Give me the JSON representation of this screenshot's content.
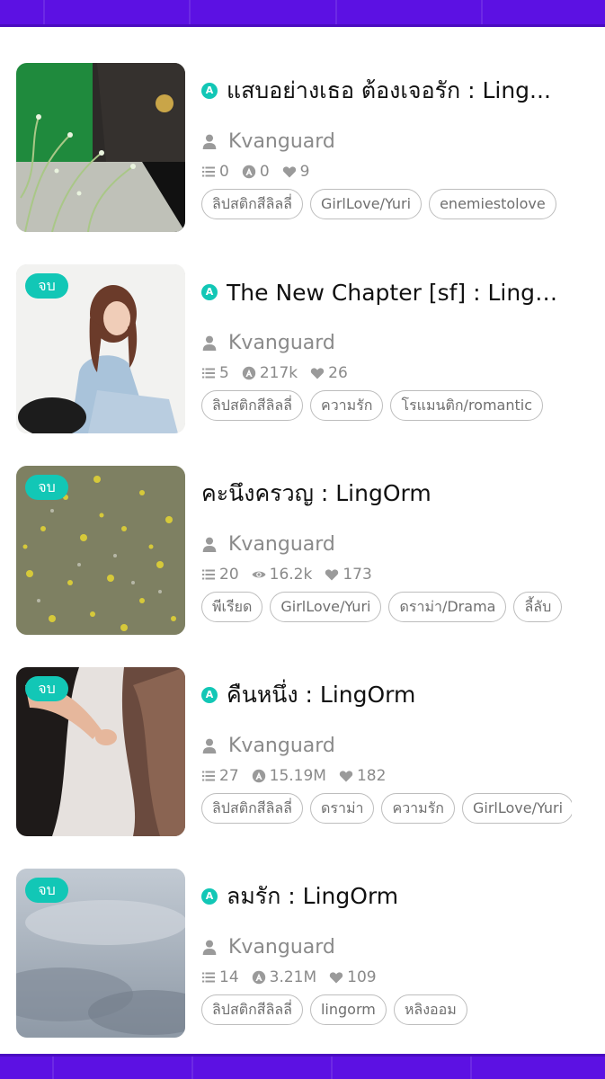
{
  "colors": {
    "accent": "#5c11e3",
    "badge": "#12c7b6",
    "muted_text": "#8a8a8a",
    "tag_border": "#bdbdbd"
  },
  "stories": [
    {
      "title": "แสบอย่างเธอ ต้องเจอรัก : Ling...",
      "status_badge": "",
      "title_icon": "verified-icon",
      "author": "Kvanguard",
      "chapters": "0",
      "views": "0",
      "views_icon": "reader-icon",
      "likes": "9",
      "tags": [
        "ลิปสติกสีลิลลี่",
        "GirlLove/Yuri",
        "enemiestolove"
      ]
    },
    {
      "title": "The New Chapter [sf] : LingO...",
      "status_badge": "จบ",
      "title_icon": "verified-icon",
      "author": "Kvanguard",
      "chapters": "5",
      "views": "217k",
      "views_icon": "reader-icon",
      "likes": "26",
      "tags": [
        "ลิปสติกสีลิลลี่",
        "ความรัก",
        "โรแมนติก/romantic"
      ]
    },
    {
      "title": "คะนึงครวญ : LingOrm",
      "status_badge": "จบ",
      "title_icon": "",
      "author": "Kvanguard",
      "chapters": "20",
      "views": "16.2k",
      "views_icon": "eye-icon",
      "likes": "173",
      "tags": [
        "พีเรียด",
        "GirlLove/Yuri",
        "ดราม่า/Drama",
        "ลี้ลับ"
      ]
    },
    {
      "title": "คืนหนึ่ง : LingOrm",
      "status_badge": "จบ",
      "title_icon": "verified-icon",
      "author": "Kvanguard",
      "chapters": "27",
      "views": "15.19M",
      "views_icon": "reader-icon",
      "likes": "182",
      "tags": [
        "ลิปสติกสีลิลลี่",
        "ดราม่า",
        "ความรัก",
        "GirlLove/Yuri"
      ]
    },
    {
      "title": "ลมรัก : LingOrm",
      "status_badge": "จบ",
      "title_icon": "verified-icon",
      "author": "Kvanguard",
      "chapters": "14",
      "views": "3.21M",
      "views_icon": "reader-icon",
      "likes": "109",
      "tags": [
        "ลิปสติกสีลิลลี่",
        "lingorm",
        "หลิงออม"
      ]
    }
  ]
}
